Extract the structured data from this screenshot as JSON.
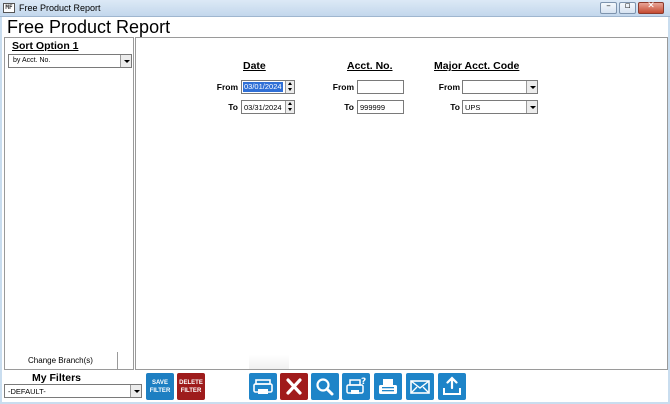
{
  "window": {
    "title": "Free Product Report",
    "icon_label": "MF"
  },
  "report": {
    "title": "Free Product Report"
  },
  "sort": {
    "label": "Sort Option 1",
    "selected": "by Acct. No."
  },
  "change_branch_label": "Change Branch(s)",
  "filters": {
    "date": {
      "header": "Date",
      "from_label": "From",
      "from_value": "03/01/2024",
      "to_label": "To",
      "to_value": "03/31/2024"
    },
    "acct": {
      "header": "Acct. No.",
      "from_label": "From",
      "from_value": "",
      "to_label": "To",
      "to_value": "999999"
    },
    "major": {
      "header": "Major Acct. Code",
      "from_label": "From",
      "from_value": "",
      "to_label": "To",
      "to_value": "UPS"
    }
  },
  "my_filters": {
    "label": "My Filters",
    "selected": "-DEFAULT-"
  },
  "buttons": {
    "save_filter": "SAVE FILTER",
    "delete_filter": "DELETE FILTER"
  },
  "toolbar_icons": [
    "print-icon",
    "cancel-icon",
    "search-icon",
    "print-setup-icon",
    "fax-icon",
    "email-icon",
    "export-icon"
  ],
  "colors": {
    "accent_blue": "#1e84c8",
    "accent_red": "#a01b1b",
    "selection": "#2f6fd6"
  }
}
